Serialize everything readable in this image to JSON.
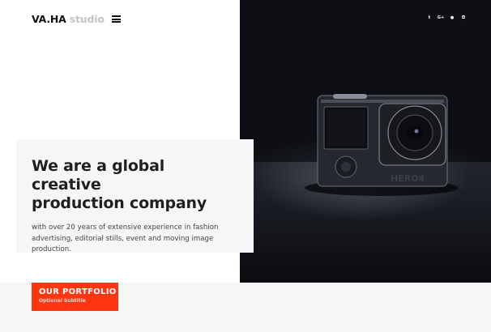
{
  "header": {
    "logo_brand": "VA.HA",
    "logo_sub": "studio"
  },
  "social": [
    {
      "name": "twitter",
      "glyph": "t"
    },
    {
      "name": "google-plus",
      "glyph": "G+"
    },
    {
      "name": "flickr",
      "glyph": "●"
    },
    {
      "name": "instagram",
      "glyph": "◘"
    }
  ],
  "hero": {
    "title_line1": "We are a global creative",
    "title_line2": "production company",
    "description": "with over 20 years of extensive experience in fashion advertising, editorial stills, event and moving image production."
  },
  "camera": {
    "brand_label": "HERO4"
  },
  "portfolio": {
    "title": "OUR PORTFOLIO",
    "subtitle": "Optional Subtitle"
  },
  "colors": {
    "accent": "#ff3611",
    "card_bg": "#f6f6f6"
  }
}
